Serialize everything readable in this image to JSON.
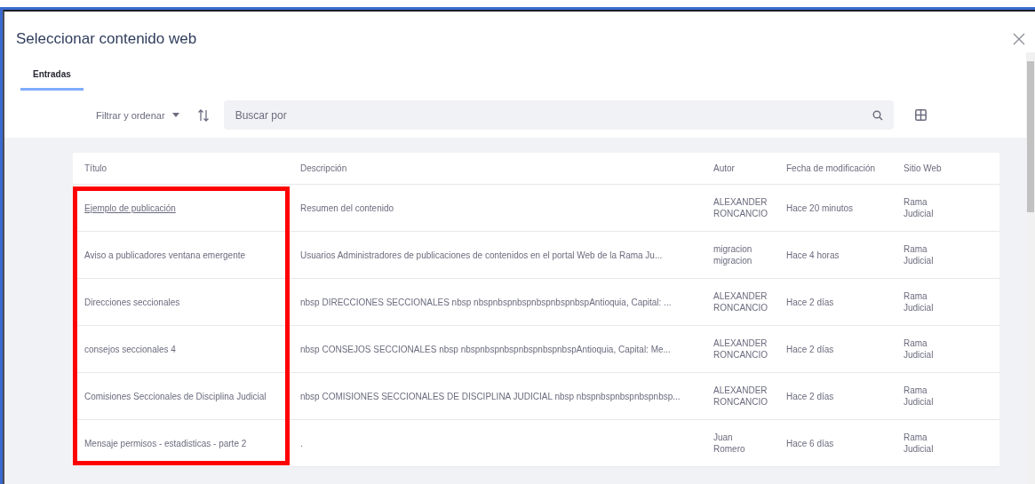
{
  "window": {
    "title": "Seleccionar contenido web"
  },
  "tabs": [
    {
      "label": "Entradas",
      "selected": true
    }
  ],
  "toolbar": {
    "filter_label": "Filtrar y ordenar",
    "search": {
      "placeholder": "Buscar por"
    }
  },
  "table": {
    "columns": [
      "Título",
      "Descripción",
      "Autor",
      "Fecha de modificación",
      "Sitio Web"
    ],
    "rows": [
      {
        "title": {
          "kind": "link",
          "text": "Ejemplo de publicación"
        },
        "description": "Resumen del contenido",
        "author": "ALEXANDER RONCANCIO",
        "modified": "Hace 20 minutos",
        "site": "Rama Judicial",
        "marked": true
      },
      {
        "title": {
          "kind": "text",
          "text": "Aviso a publicadores ventana emergente"
        },
        "description": "Usuarios Administradores de publicaciones de contenidos en el portal Web de la Rama Ju...",
        "author": "migracion migracion",
        "modified": "Hace 4 horas",
        "site": "Rama Judicial",
        "marked": true
      },
      {
        "title": {
          "kind": "text",
          "text": "Direcciones seccionales"
        },
        "description": "nbsp DIRECCIONES SECCIONALES nbsp nbspnbspnbspnbspnbspnbspAntioquia, Capital: ...",
        "author": "ALEXANDER RONCANCIO",
        "modified": "Hace 2 días",
        "site": "Rama Judicial",
        "marked": true
      },
      {
        "title": {
          "kind": "text",
          "text": "consejos seccionales 4"
        },
        "description": "nbsp CONSEJOS SECCIONALES nbsp nbspnbspnbspnbspnbspnbspAntioquia, Capital: Me...",
        "author": "ALEXANDER RONCANCIO",
        "modified": "Hace 2 días",
        "site": "Rama Judicial",
        "marked": true
      },
      {
        "title": {
          "kind": "text",
          "text": "Comisiones Seccionales de Disciplina Judicial"
        },
        "description": "nbsp COMISIONES SECCIONALES DE DISCIPLINA JUDICIAL nbsp nbspnbspnbspnbspnbsp...",
        "author": "ALEXANDER RONCANCIO",
        "modified": "Hace 2 días",
        "site": "Rama Judicial",
        "marked": true
      },
      {
        "title": {
          "kind": "text",
          "text": "Mensaje permisos - estadisticas - parte 2"
        },
        "description": ".",
        "author": "Juan Romero",
        "modified": "Hace 6 días",
        "site": "Rama Judicial",
        "marked": true
      }
    ]
  }
}
